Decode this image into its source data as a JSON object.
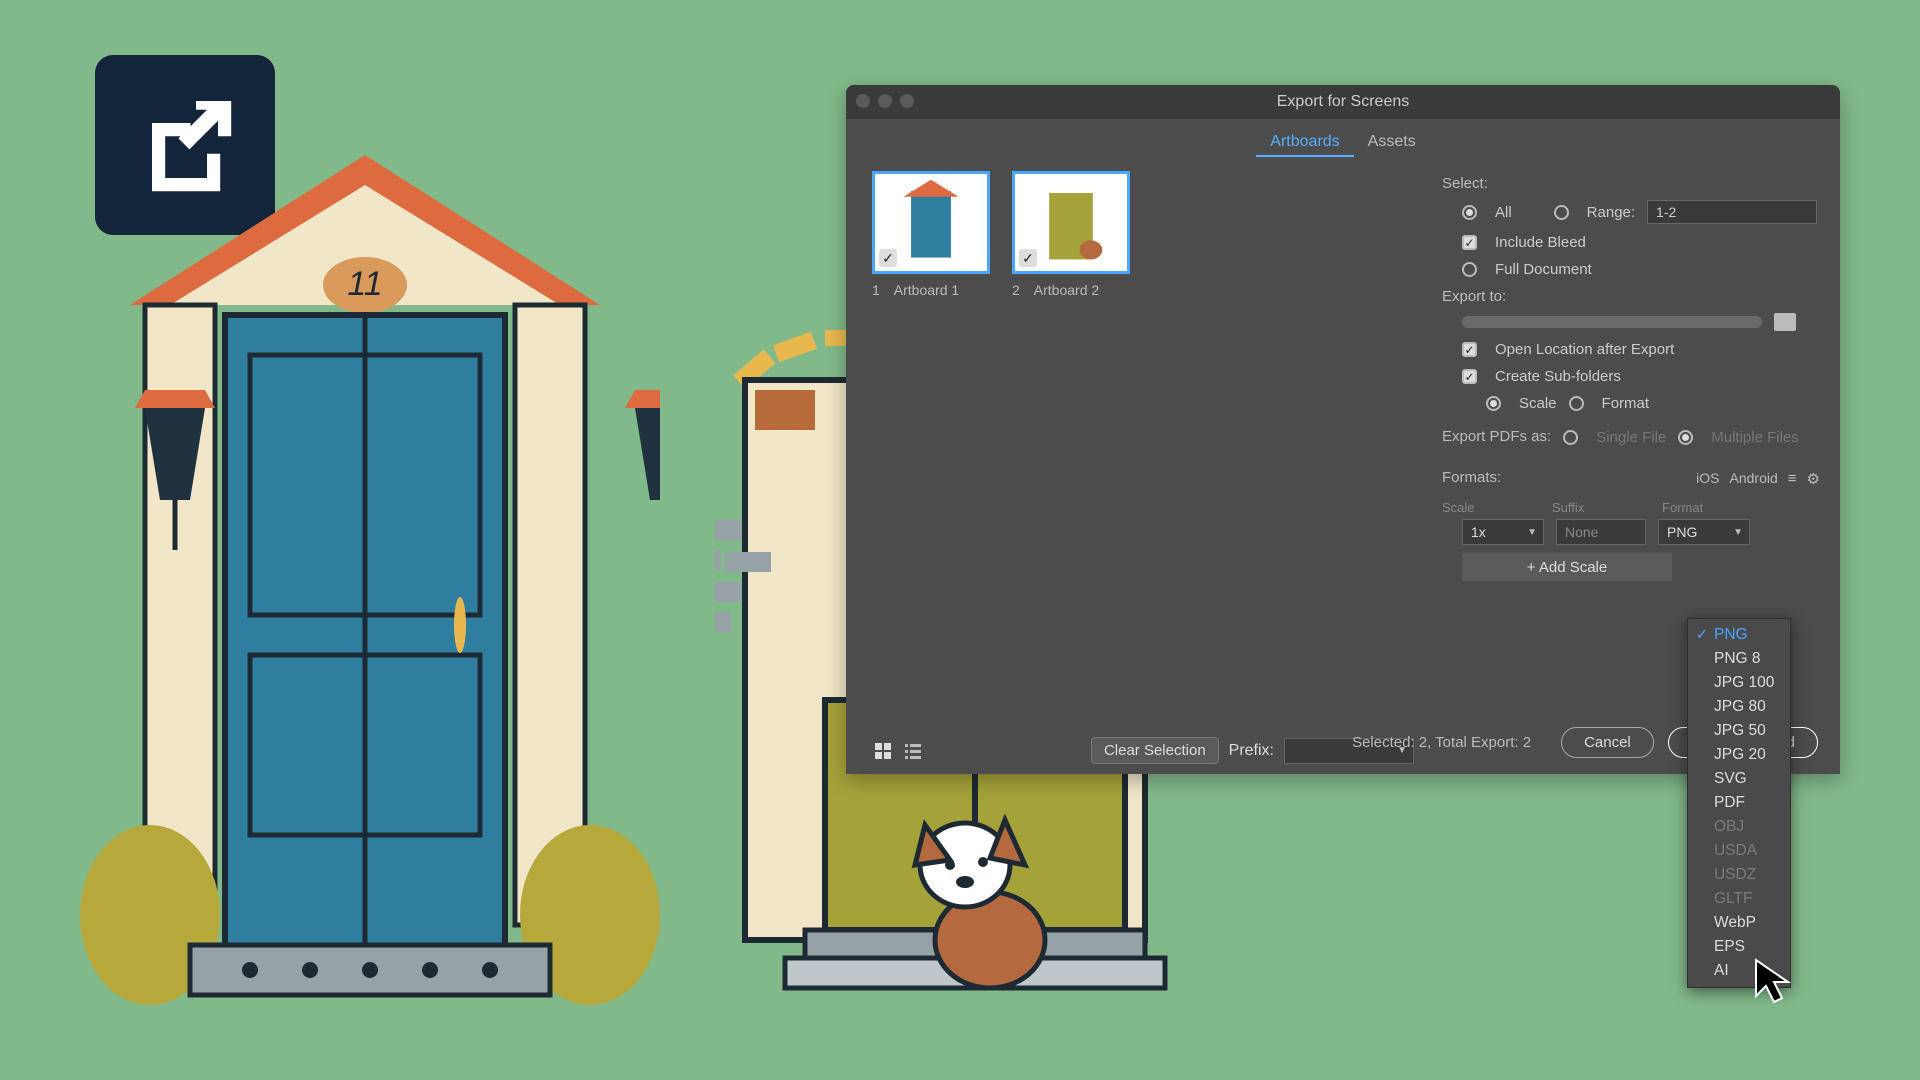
{
  "dialog": {
    "title": "Export for Screens",
    "tabs": {
      "artboards": "Artboards",
      "assets": "Assets"
    },
    "artboards": [
      {
        "num": "1",
        "name": "Artboard 1"
      },
      {
        "num": "2",
        "name": "Artboard 2"
      }
    ],
    "clear_selection": "Clear Selection",
    "prefix_label": "Prefix:",
    "prefix_value": "",
    "selected_text": "Selected: 2, Total Export: 2",
    "cancel": "Cancel",
    "export_btn": "Export Artboard"
  },
  "right": {
    "select_label": "Select:",
    "all": "All",
    "range": "Range:",
    "range_value": "1-2",
    "include_bleed": "Include Bleed",
    "full_document": "Full Document",
    "export_to": "Export to:",
    "open_after": "Open Location after Export",
    "create_sub": "Create Sub-folders",
    "scale_opt": "Scale",
    "format_opt": "Format",
    "export_pdfs": "Export PDFs as:",
    "single_file": "Single File",
    "multiple_files": "Multiple Files",
    "formats_label": "Formats:",
    "ios": "iOS",
    "android": "Android",
    "col_scale": "Scale",
    "col_suffix": "Suffix",
    "col_format": "Format",
    "scale_value": "1x",
    "suffix_value": "None",
    "format_value": "PNG",
    "add_scale": "+ Add Scale"
  },
  "format_menu": [
    {
      "label": "PNG",
      "state": "sel"
    },
    {
      "label": "PNG 8",
      "state": ""
    },
    {
      "label": "JPG 100",
      "state": ""
    },
    {
      "label": "JPG 80",
      "state": ""
    },
    {
      "label": "JPG 50",
      "state": ""
    },
    {
      "label": "JPG 20",
      "state": ""
    },
    {
      "label": "SVG",
      "state": ""
    },
    {
      "label": "PDF",
      "state": ""
    },
    {
      "label": "OBJ",
      "state": "dis"
    },
    {
      "label": "USDA",
      "state": "dis"
    },
    {
      "label": "USDZ",
      "state": "dis"
    },
    {
      "label": "GLTF",
      "state": "dis"
    },
    {
      "label": "WebP",
      "state": ""
    },
    {
      "label": "EPS",
      "state": ""
    },
    {
      "label": "AI",
      "state": ""
    }
  ],
  "illus": {
    "house_number": "11"
  }
}
